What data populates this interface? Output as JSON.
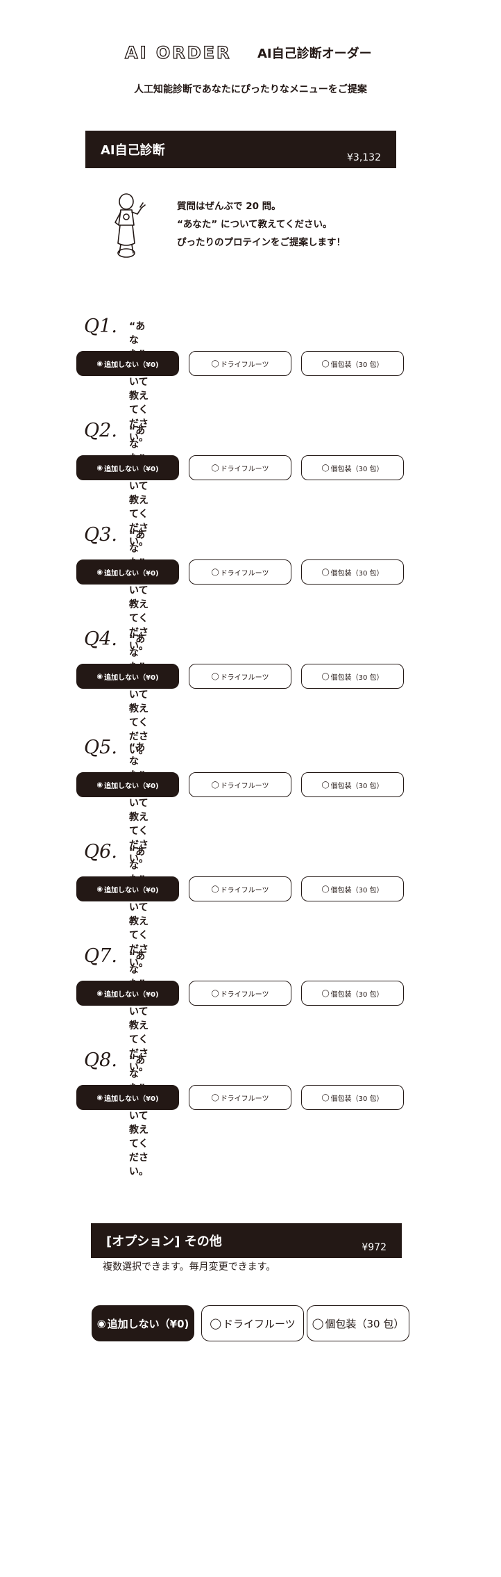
{
  "header": {
    "logo": "AI ORDER",
    "title": "AI自己診断オーダー",
    "subtitle": "人工知能診断であなたにぴったりなメニューをご提案"
  },
  "diagnosis": {
    "title": "AI自己診断",
    "price": "¥3,132",
    "intro": [
      "質問はぜんぶで 20 問。",
      "“あなた” について教えてください。",
      "ぴったりのプロテインをご提案します！"
    ]
  },
  "questions": [
    {
      "num": "Q1.",
      "text": "“あなた” について教えてください。"
    },
    {
      "num": "Q2.",
      "text": "“あなた” について教えてください。"
    },
    {
      "num": "Q3.",
      "text": "“あなた” について教えてください。"
    },
    {
      "num": "Q4.",
      "text": "“あなた” について教えてください。"
    },
    {
      "num": "Q5.",
      "text": "“あなた” について教えてください。"
    },
    {
      "num": "Q6.",
      "text": "“あなた” について教えてください。"
    },
    {
      "num": "Q7.",
      "text": "“あなた” について教えてください。"
    },
    {
      "num": "Q8.",
      "text": "“あなた” について教えてください。"
    }
  ],
  "question_options": [
    {
      "label": "追加しない（¥0)",
      "selected": true,
      "mark": "◉"
    },
    {
      "label": "ドライフルーツ",
      "selected": false,
      "mark": "◯"
    },
    {
      "label": "個包装（30 包）",
      "selected": false,
      "mark": "◯"
    }
  ],
  "option_section": {
    "title": "[オプション] その他",
    "price": "¥972",
    "note": "複数選択できます。毎月変更できます。",
    "options": [
      {
        "label": "追加しない（¥0)",
        "selected": true,
        "mark": "◉"
      },
      {
        "label": "ドライフルーツ",
        "selected": false,
        "mark": "◯"
      },
      {
        "label": "個包装（30 包）",
        "selected": false,
        "mark": "◯"
      }
    ]
  },
  "colors": {
    "ink": "#231815",
    "background": "#ffffff"
  }
}
